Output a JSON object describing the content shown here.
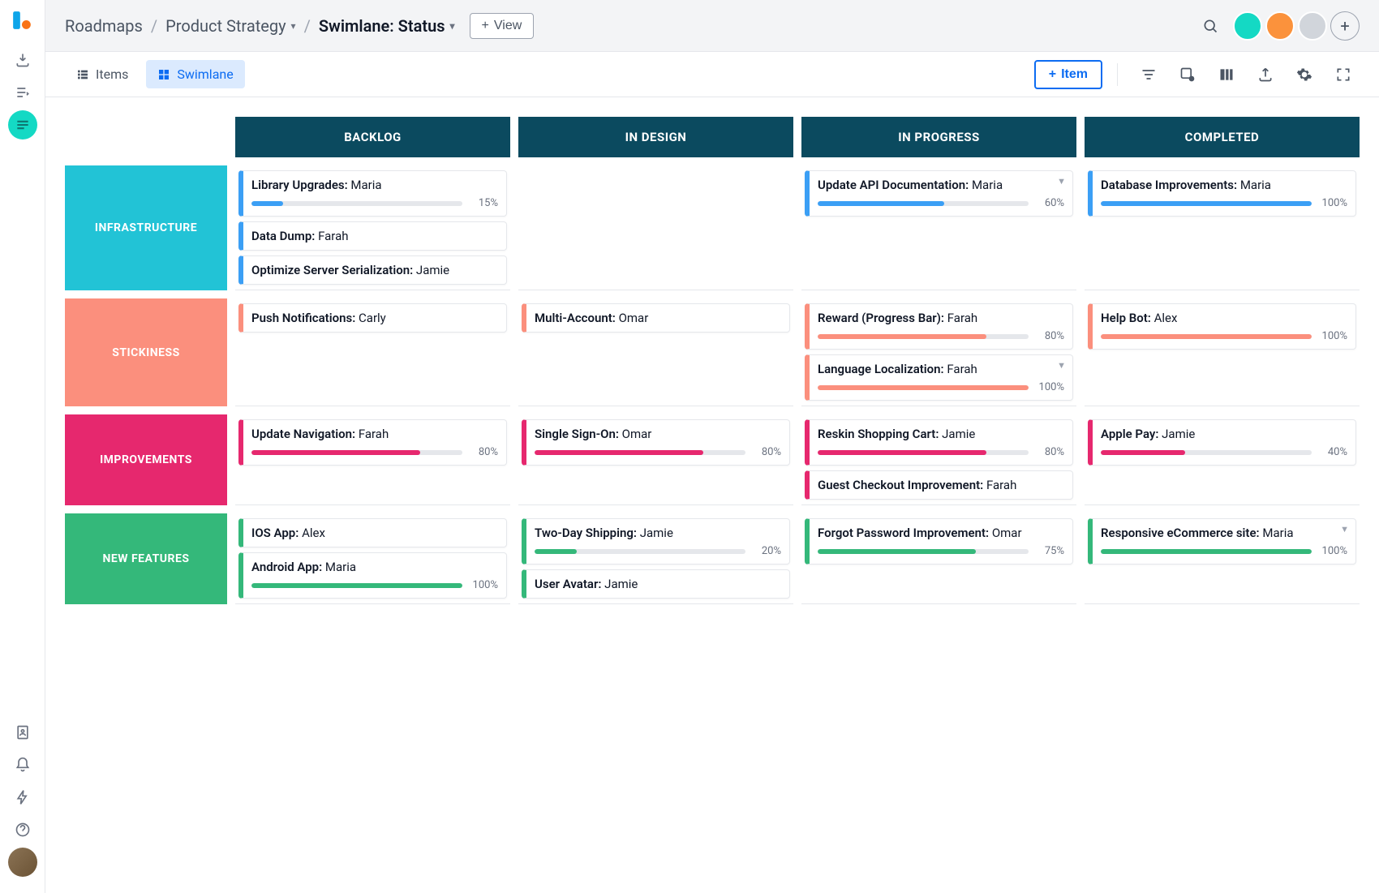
{
  "breadcrumb": {
    "root": "Roadmaps",
    "project": "Product Strategy",
    "view": "Swimlane: Status"
  },
  "topbar": {
    "view_btn": "View"
  },
  "tabs": {
    "items": "Items",
    "swimlane": "Swimlane"
  },
  "toolbar": {
    "add_item": "Item"
  },
  "columns": [
    "BACKLOG",
    "IN DESIGN",
    "IN PROGRESS",
    "COMPLETED"
  ],
  "rows": [
    {
      "key": "infra",
      "label": "INFRASTRUCTURE",
      "color": "infra"
    },
    {
      "key": "stick",
      "label": "STICKINESS",
      "color": "stick"
    },
    {
      "key": "improve",
      "label": "IMPROVEMENTS",
      "color": "improve"
    },
    {
      "key": "feat",
      "label": "NEW FEATURES",
      "color": "feat"
    }
  ],
  "cards": {
    "infra": {
      "backlog": [
        {
          "title": "Library Upgrades:",
          "assignee": "Maria",
          "progress": 15
        },
        {
          "title": "Data Dump:",
          "assignee": "Farah"
        },
        {
          "title": "Optimize Server Serialization:",
          "assignee": "Jamie"
        }
      ],
      "design": [],
      "progress": [
        {
          "title": "Update API Documentation:",
          "assignee": "Maria",
          "progress": 60,
          "menu": true
        }
      ],
      "completed": [
        {
          "title": "Database Improvements:",
          "assignee": "Maria",
          "progress": 100
        }
      ]
    },
    "stick": {
      "backlog": [
        {
          "title": "Push Notifications:",
          "assignee": "Carly"
        }
      ],
      "design": [
        {
          "title": "Multi-Account:",
          "assignee": "Omar"
        }
      ],
      "progress": [
        {
          "title": "Reward (Progress Bar):",
          "assignee": "Farah",
          "progress": 80
        },
        {
          "title": "Language Localization:",
          "assignee": "Farah",
          "progress": 100,
          "menu": true
        }
      ],
      "completed": [
        {
          "title": "Help Bot:",
          "assignee": "Alex",
          "progress": 100
        }
      ]
    },
    "improve": {
      "backlog": [
        {
          "title": "Update Navigation:",
          "assignee": "Farah",
          "progress": 80
        }
      ],
      "design": [
        {
          "title": "Single Sign-On:",
          "assignee": "Omar",
          "progress": 80
        }
      ],
      "progress": [
        {
          "title": "Reskin Shopping Cart:",
          "assignee": "Jamie",
          "progress": 80
        },
        {
          "title": "Guest Checkout Improvement:",
          "assignee": "Farah"
        }
      ],
      "completed": [
        {
          "title": "Apple Pay:",
          "assignee": "Jamie",
          "progress": 40
        }
      ]
    },
    "feat": {
      "backlog": [
        {
          "title": "IOS App:",
          "assignee": "Alex"
        },
        {
          "title": "Android App:",
          "assignee": "Maria",
          "progress": 100
        }
      ],
      "design": [
        {
          "title": "Two-Day Shipping:",
          "assignee": "Jamie",
          "progress": 20
        },
        {
          "title": "User Avatar:",
          "assignee": "Jamie"
        }
      ],
      "progress": [
        {
          "title": "Forgot Password Improvement:",
          "assignee": "Omar",
          "progress": 75
        }
      ],
      "completed": [
        {
          "title": "Responsive eCommerce site:",
          "assignee": "Maria",
          "progress": 100,
          "menu": true
        }
      ]
    }
  }
}
